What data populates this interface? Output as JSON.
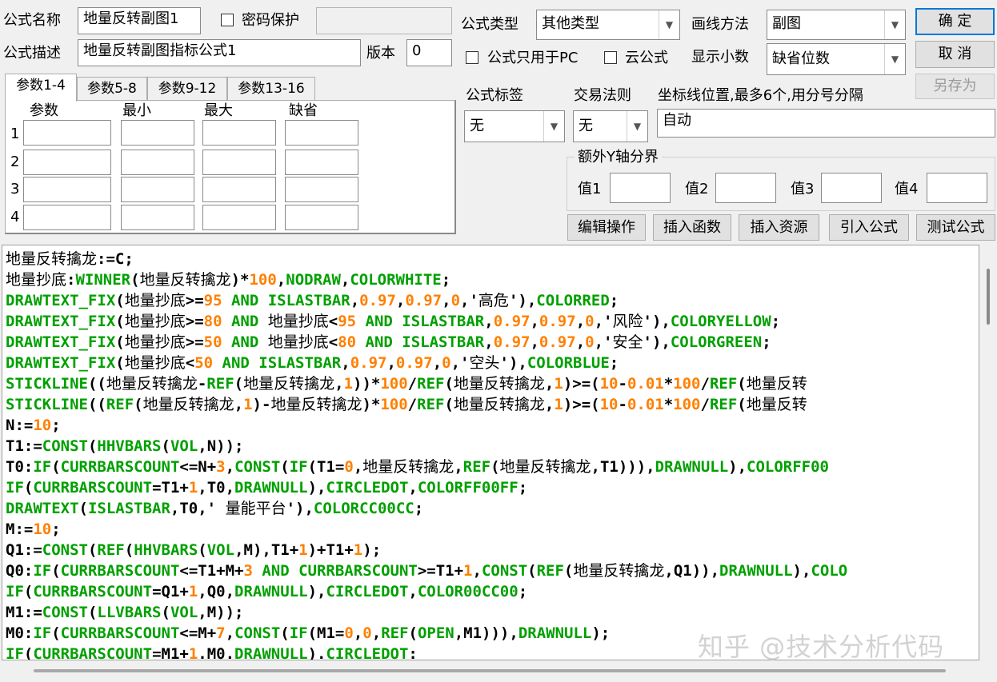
{
  "form": {
    "name_label": "公式名称",
    "name_value": "地量反转副图1",
    "pwd_label": "密码保护",
    "pwd_value": "",
    "desc_label": "公式描述",
    "desc_value": "地量反转副图指标公式1",
    "version_label": "版本",
    "version_value": "0"
  },
  "type": {
    "label": "公式类型",
    "value": "其他类型",
    "draw_label": "画线方法",
    "draw_value": "副图",
    "pc_only_label": "公式只用于PC",
    "cloud_label": "云公式",
    "decimals_label": "显示小数",
    "decimals_value": "缺省位数"
  },
  "buttons": {
    "ok": "确  定",
    "cancel": "取  消",
    "save_as": "另存为"
  },
  "tabs": [
    "参数1-4",
    "参数5-8",
    "参数9-12",
    "参数13-16"
  ],
  "params": {
    "headers": [
      "参数",
      "最小",
      "最大",
      "缺省"
    ],
    "rows": [
      "1",
      "2",
      "3",
      "4"
    ]
  },
  "tag": {
    "label": "公式标签",
    "value": "无",
    "rule_label": "交易法则",
    "rule_value": "无",
    "axis_label": "坐标线位置,最多6个,用分号分隔",
    "axis_value": "自动"
  },
  "yaxis": {
    "group_label": "额外Y轴分界",
    "labels": [
      "值1",
      "值2",
      "值3",
      "值4"
    ]
  },
  "actions": [
    "编辑操作",
    "插入函数",
    "插入资源",
    "引入公式",
    "测试公式"
  ],
  "colors": {
    "kw": "#00a000",
    "num": "#ff8000",
    "plain": "#000000"
  },
  "code_lines": [
    [
      [
        "p",
        "地量反转擒龙:=C;"
      ]
    ],
    [
      [
        "p",
        "地量抄底:"
      ],
      [
        "k",
        "WINNER"
      ],
      [
        "p",
        "(地量反转擒龙)*"
      ],
      [
        "n",
        "100"
      ],
      [
        "p",
        ","
      ],
      [
        "k",
        "NODRAW"
      ],
      [
        "p",
        ","
      ],
      [
        "k",
        "COLORWHITE"
      ],
      [
        "p",
        ";"
      ]
    ],
    [
      [
        "k",
        "DRAWTEXT_FIX"
      ],
      [
        "p",
        "(地量抄底>="
      ],
      [
        "n",
        "95"
      ],
      [
        "k",
        " AND ISLASTBAR"
      ],
      [
        "p",
        ","
      ],
      [
        "n",
        "0.97"
      ],
      [
        "p",
        ","
      ],
      [
        "n",
        "0.97"
      ],
      [
        "p",
        ","
      ],
      [
        "n",
        "0"
      ],
      [
        "p",
        ",'高危'),"
      ],
      [
        "k",
        "COLORRED"
      ],
      [
        "p",
        ";"
      ]
    ],
    [
      [
        "k",
        "DRAWTEXT_FIX"
      ],
      [
        "p",
        "(地量抄底>="
      ],
      [
        "n",
        "80"
      ],
      [
        "k",
        " AND "
      ],
      [
        "p",
        "地量抄底<"
      ],
      [
        "n",
        "95"
      ],
      [
        "k",
        " AND ISLASTBAR"
      ],
      [
        "p",
        ","
      ],
      [
        "n",
        "0.97"
      ],
      [
        "p",
        ","
      ],
      [
        "n",
        "0.97"
      ],
      [
        "p",
        ","
      ],
      [
        "n",
        "0"
      ],
      [
        "p",
        ",'风险'),"
      ],
      [
        "k",
        "COLORYELLOW"
      ],
      [
        "p",
        ";"
      ]
    ],
    [
      [
        "k",
        "DRAWTEXT_FIX"
      ],
      [
        "p",
        "(地量抄底>="
      ],
      [
        "n",
        "50"
      ],
      [
        "k",
        " AND "
      ],
      [
        "p",
        "地量抄底<"
      ],
      [
        "n",
        "80"
      ],
      [
        "k",
        " AND ISLASTBAR"
      ],
      [
        "p",
        ","
      ],
      [
        "n",
        "0.97"
      ],
      [
        "p",
        ","
      ],
      [
        "n",
        "0.97"
      ],
      [
        "p",
        ","
      ],
      [
        "n",
        "0"
      ],
      [
        "p",
        ",'安全'),"
      ],
      [
        "k",
        "COLORGREEN"
      ],
      [
        "p",
        ";"
      ]
    ],
    [
      [
        "k",
        "DRAWTEXT_FIX"
      ],
      [
        "p",
        "(地量抄底<"
      ],
      [
        "n",
        "50"
      ],
      [
        "k",
        " AND ISLASTBAR"
      ],
      [
        "p",
        ","
      ],
      [
        "n",
        "0.97"
      ],
      [
        "p",
        ","
      ],
      [
        "n",
        "0.97"
      ],
      [
        "p",
        ","
      ],
      [
        "n",
        "0"
      ],
      [
        "p",
        ",'空头'),"
      ],
      [
        "k",
        "COLORBLUE"
      ],
      [
        "p",
        ";"
      ]
    ],
    [
      [
        "k",
        "STICKLINE"
      ],
      [
        "p",
        "((地量反转擒龙-"
      ],
      [
        "k",
        "REF"
      ],
      [
        "p",
        "(地量反转擒龙,"
      ],
      [
        "n",
        "1"
      ],
      [
        "p",
        "))*"
      ],
      [
        "n",
        "100"
      ],
      [
        "p",
        "/"
      ],
      [
        "k",
        "REF"
      ],
      [
        "p",
        "(地量反转擒龙,"
      ],
      [
        "n",
        "1"
      ],
      [
        "p",
        ")>=("
      ],
      [
        "n",
        "10"
      ],
      [
        "p",
        "-"
      ],
      [
        "n",
        "0.01"
      ],
      [
        "p",
        "*"
      ],
      [
        "n",
        "100"
      ],
      [
        "p",
        "/"
      ],
      [
        "k",
        "REF"
      ],
      [
        "p",
        "(地量反转"
      ]
    ],
    [
      [
        "k",
        "STICKLINE"
      ],
      [
        "p",
        "(("
      ],
      [
        "k",
        "REF"
      ],
      [
        "p",
        "(地量反转擒龙,"
      ],
      [
        "n",
        "1"
      ],
      [
        "p",
        ")-地量反转擒龙)*"
      ],
      [
        "n",
        "100"
      ],
      [
        "p",
        "/"
      ],
      [
        "k",
        "REF"
      ],
      [
        "p",
        "(地量反转擒龙,"
      ],
      [
        "n",
        "1"
      ],
      [
        "p",
        ")>=("
      ],
      [
        "n",
        "10"
      ],
      [
        "p",
        "-"
      ],
      [
        "n",
        "0.01"
      ],
      [
        "p",
        "*"
      ],
      [
        "n",
        "100"
      ],
      [
        "p",
        "/"
      ],
      [
        "k",
        "REF"
      ],
      [
        "p",
        "(地量反转"
      ]
    ],
    [
      [
        "p",
        "N:="
      ],
      [
        "n",
        "10"
      ],
      [
        "p",
        ";"
      ]
    ],
    [
      [
        "p",
        "T1:="
      ],
      [
        "k",
        "CONST"
      ],
      [
        "p",
        "("
      ],
      [
        "k",
        "HHVBARS"
      ],
      [
        "p",
        "("
      ],
      [
        "k",
        "VOL"
      ],
      [
        "p",
        ",N));"
      ]
    ],
    [
      [
        "p",
        "T0:"
      ],
      [
        "k",
        "IF"
      ],
      [
        "p",
        "("
      ],
      [
        "k",
        "CURRBARSCOUNT"
      ],
      [
        "p",
        "<=N+"
      ],
      [
        "n",
        "3"
      ],
      [
        "p",
        ","
      ],
      [
        "k",
        "CONST"
      ],
      [
        "p",
        "("
      ],
      [
        "k",
        "IF"
      ],
      [
        "p",
        "(T1="
      ],
      [
        "n",
        "0"
      ],
      [
        "p",
        ",地量反转擒龙,"
      ],
      [
        "k",
        "REF"
      ],
      [
        "p",
        "(地量反转擒龙,T1))),"
      ],
      [
        "k",
        "DRAWNULL"
      ],
      [
        "p",
        "),"
      ],
      [
        "k",
        "COLORFF00"
      ]
    ],
    [
      [
        "k",
        "IF"
      ],
      [
        "p",
        "("
      ],
      [
        "k",
        "CURRBARSCOUNT"
      ],
      [
        "p",
        "=T1+"
      ],
      [
        "n",
        "1"
      ],
      [
        "p",
        ",T0,"
      ],
      [
        "k",
        "DRAWNULL"
      ],
      [
        "p",
        "),"
      ],
      [
        "k",
        "CIRCLEDOT"
      ],
      [
        "p",
        ","
      ],
      [
        "k",
        "COLORFF00FF"
      ],
      [
        "p",
        ";"
      ]
    ],
    [
      [
        "k",
        "DRAWTEXT"
      ],
      [
        "p",
        "("
      ],
      [
        "k",
        "ISLASTBAR"
      ],
      [
        "p",
        ",T0,' 量能平台'),"
      ],
      [
        "k",
        "COLORCC00CC"
      ],
      [
        "p",
        ";"
      ]
    ],
    [
      [
        "p",
        "M:="
      ],
      [
        "n",
        "10"
      ],
      [
        "p",
        ";"
      ]
    ],
    [
      [
        "p",
        "Q1:="
      ],
      [
        "k",
        "CONST"
      ],
      [
        "p",
        "("
      ],
      [
        "k",
        "REF"
      ],
      [
        "p",
        "("
      ],
      [
        "k",
        "HHVBARS"
      ],
      [
        "p",
        "("
      ],
      [
        "k",
        "VOL"
      ],
      [
        "p",
        ",M),T1+"
      ],
      [
        "n",
        "1"
      ],
      [
        "p",
        ")+T1+"
      ],
      [
        "n",
        "1"
      ],
      [
        "p",
        ");"
      ]
    ],
    [
      [
        "p",
        "Q0:"
      ],
      [
        "k",
        "IF"
      ],
      [
        "p",
        "("
      ],
      [
        "k",
        "CURRBARSCOUNT"
      ],
      [
        "p",
        "<=T1+M+"
      ],
      [
        "n",
        "3"
      ],
      [
        "k",
        " AND CURRBARSCOUNT"
      ],
      [
        "p",
        ">=T1+"
      ],
      [
        "n",
        "1"
      ],
      [
        "p",
        ","
      ],
      [
        "k",
        "CONST"
      ],
      [
        "p",
        "("
      ],
      [
        "k",
        "REF"
      ],
      [
        "p",
        "(地量反转擒龙,Q1)),"
      ],
      [
        "k",
        "DRAWNULL"
      ],
      [
        "p",
        "),"
      ],
      [
        "k",
        "COLO"
      ]
    ],
    [
      [
        "k",
        "IF"
      ],
      [
        "p",
        "("
      ],
      [
        "k",
        "CURRBARSCOUNT"
      ],
      [
        "p",
        "=Q1+"
      ],
      [
        "n",
        "1"
      ],
      [
        "p",
        ",Q0,"
      ],
      [
        "k",
        "DRAWNULL"
      ],
      [
        "p",
        "),"
      ],
      [
        "k",
        "CIRCLEDOT"
      ],
      [
        "p",
        ","
      ],
      [
        "k",
        "COLOR00CC00"
      ],
      [
        "p",
        ";"
      ]
    ],
    [
      [
        "p",
        "M1:="
      ],
      [
        "k",
        "CONST"
      ],
      [
        "p",
        "("
      ],
      [
        "k",
        "LLVBARS"
      ],
      [
        "p",
        "("
      ],
      [
        "k",
        "VOL"
      ],
      [
        "p",
        ",M));"
      ]
    ],
    [
      [
        "p",
        "M0:"
      ],
      [
        "k",
        "IF"
      ],
      [
        "p",
        "("
      ],
      [
        "k",
        "CURRBARSCOUNT"
      ],
      [
        "p",
        "<=M+"
      ],
      [
        "n",
        "7"
      ],
      [
        "p",
        ","
      ],
      [
        "k",
        "CONST"
      ],
      [
        "p",
        "("
      ],
      [
        "k",
        "IF"
      ],
      [
        "p",
        "(M1="
      ],
      [
        "n",
        "0"
      ],
      [
        "p",
        ","
      ],
      [
        "n",
        "0"
      ],
      [
        "p",
        ","
      ],
      [
        "k",
        "REF"
      ],
      [
        "p",
        "("
      ],
      [
        "k",
        "OPEN"
      ],
      [
        "p",
        ",M1))),"
      ],
      [
        "k",
        "DRAWNULL"
      ],
      [
        "p",
        ");"
      ]
    ],
    [
      [
        "k",
        "IF"
      ],
      [
        "p",
        "("
      ],
      [
        "k",
        "CURRBARSCOUNT"
      ],
      [
        "p",
        "=M1+"
      ],
      [
        "n",
        "1"
      ],
      [
        "p",
        ".M0."
      ],
      [
        "k",
        "DRAWNULL"
      ],
      [
        "p",
        ")."
      ],
      [
        "k",
        "CIRCLEDOT"
      ],
      [
        "p",
        ":"
      ]
    ]
  ],
  "watermark": "知乎 @技术分析代码"
}
